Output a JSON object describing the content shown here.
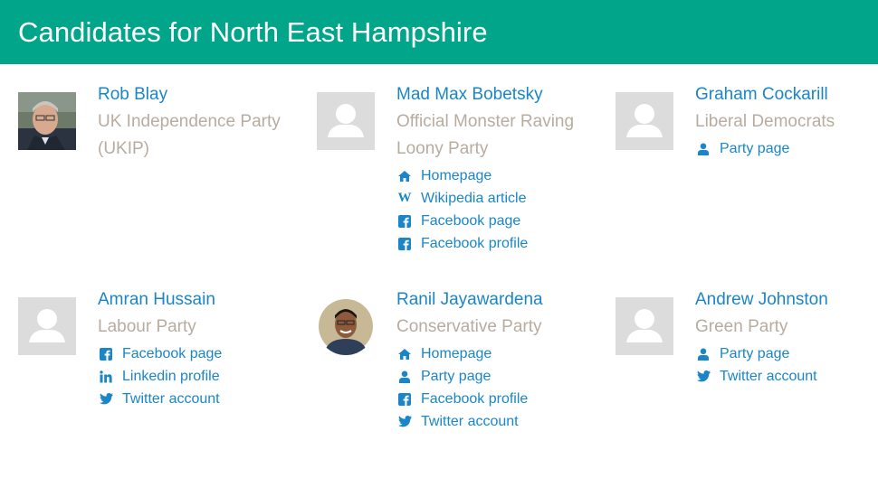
{
  "page": {
    "title": "Candidates for North East Hampshire"
  },
  "colors": {
    "header_bg": "#00a58a",
    "link": "#1a86c8",
    "party": "#b8aca0",
    "placeholder": "#dcdcdc"
  },
  "candidates": [
    {
      "name": "Rob Blay",
      "party": "UK Independence Party (UKIP)",
      "photo": "photo",
      "links": []
    },
    {
      "name": "Mad Max Bobetsky",
      "party": "Official Monster Raving Loony Party",
      "photo": "placeholder",
      "links": [
        {
          "icon": "home-icon",
          "label": "Homepage"
        },
        {
          "icon": "wikipedia-icon",
          "label": "Wikipedia article"
        },
        {
          "icon": "facebook-icon",
          "label": "Facebook page"
        },
        {
          "icon": "facebook-icon",
          "label": "Facebook profile"
        }
      ]
    },
    {
      "name": "Graham Cockarill",
      "party": "Liberal Democrats",
      "photo": "placeholder",
      "links": [
        {
          "icon": "user-icon",
          "label": "Party page"
        }
      ]
    },
    {
      "name": "Amran Hussain",
      "party": "Labour Party",
      "photo": "placeholder",
      "links": [
        {
          "icon": "facebook-icon",
          "label": "Facebook page"
        },
        {
          "icon": "linkedin-icon",
          "label": "Linkedin profile"
        },
        {
          "icon": "twitter-icon",
          "label": "Twitter account"
        }
      ]
    },
    {
      "name": "Ranil Jayawardena",
      "party": "Conservative Party",
      "photo": "photo-round",
      "links": [
        {
          "icon": "home-icon",
          "label": "Homepage"
        },
        {
          "icon": "user-icon",
          "label": "Party page"
        },
        {
          "icon": "facebook-icon",
          "label": "Facebook profile"
        },
        {
          "icon": "twitter-icon",
          "label": "Twitter account"
        }
      ]
    },
    {
      "name": "Andrew Johnston",
      "party": "Green Party",
      "photo": "placeholder",
      "links": [
        {
          "icon": "user-icon",
          "label": "Party page"
        },
        {
          "icon": "twitter-icon",
          "label": "Twitter account"
        }
      ]
    }
  ]
}
